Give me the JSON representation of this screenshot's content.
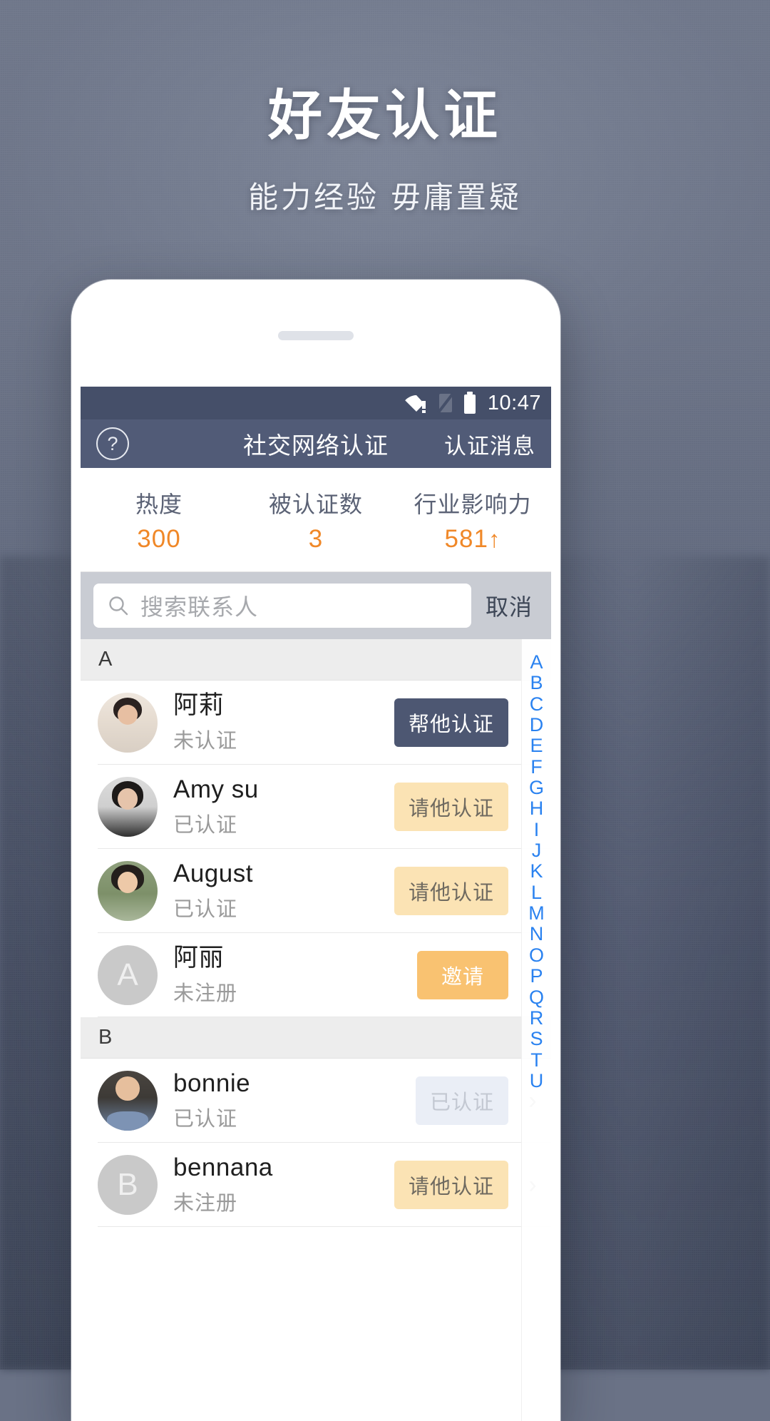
{
  "hero": {
    "title": "好友认证",
    "subtitle": "能力经验 毋庸置疑"
  },
  "statusbar": {
    "time": "10:47",
    "wifi_icon": "wifi-warning-icon",
    "signal_icon": "signal-off-icon",
    "battery_icon": "battery-full-icon"
  },
  "navbar": {
    "help_icon": "question-mark-icon",
    "title": "社交网络认证",
    "action_label": "认证消息"
  },
  "stats": [
    {
      "label": "热度",
      "value": "300",
      "arrow": ""
    },
    {
      "label": "被认证数",
      "value": "3",
      "arrow": ""
    },
    {
      "label": "行业影响力",
      "value": "581",
      "arrow": "↑"
    }
  ],
  "search": {
    "icon": "search-icon",
    "placeholder": "搜索联系人",
    "value": "",
    "cancel_label": "取消"
  },
  "sections": [
    {
      "letter": "A",
      "rows": [
        {
          "name": "阿莉",
          "status": "未认证",
          "action": "帮他认证",
          "action_style": "help",
          "avatar": "photo",
          "avatar_class": "ph-ali",
          "initial": ""
        },
        {
          "name": "Amy su",
          "status": "已认证",
          "action": "请他认证",
          "action_style": "ask",
          "avatar": "photo",
          "avatar_class": "ph-amy",
          "initial": ""
        },
        {
          "name": "August",
          "status": "已认证",
          "action": "请他认证",
          "action_style": "ask",
          "avatar": "photo",
          "avatar_class": "ph-aug",
          "initial": ""
        },
        {
          "name": "阿丽",
          "status": "未注册",
          "action": "邀请",
          "action_style": "invite",
          "avatar": "initial",
          "avatar_class": "",
          "initial": "A"
        }
      ]
    },
    {
      "letter": "B",
      "rows": [
        {
          "name": "bonnie",
          "status": "已认证",
          "action": "已认证",
          "action_style": "done",
          "avatar": "photo",
          "avatar_class": "ph-bon",
          "initial": ""
        },
        {
          "name": "bennana",
          "status": "未注册",
          "action": "请他认证",
          "action_style": "ask",
          "avatar": "initial",
          "avatar_class": "",
          "initial": "B"
        }
      ]
    }
  ],
  "alpha_index": [
    "A",
    "B",
    "C",
    "D",
    "E",
    "F",
    "G",
    "H",
    "I",
    "J",
    "K",
    "L",
    "M",
    "N",
    "O",
    "P",
    "Q",
    "R",
    "S",
    "T",
    "U"
  ],
  "colors": {
    "accent_orange": "#f08828",
    "nav_bg": "#515b77",
    "status_bg": "#454f69",
    "index_blue": "#2a82f0",
    "invite_amber": "#f9c271",
    "ask_amber": "#fbe3b4"
  }
}
